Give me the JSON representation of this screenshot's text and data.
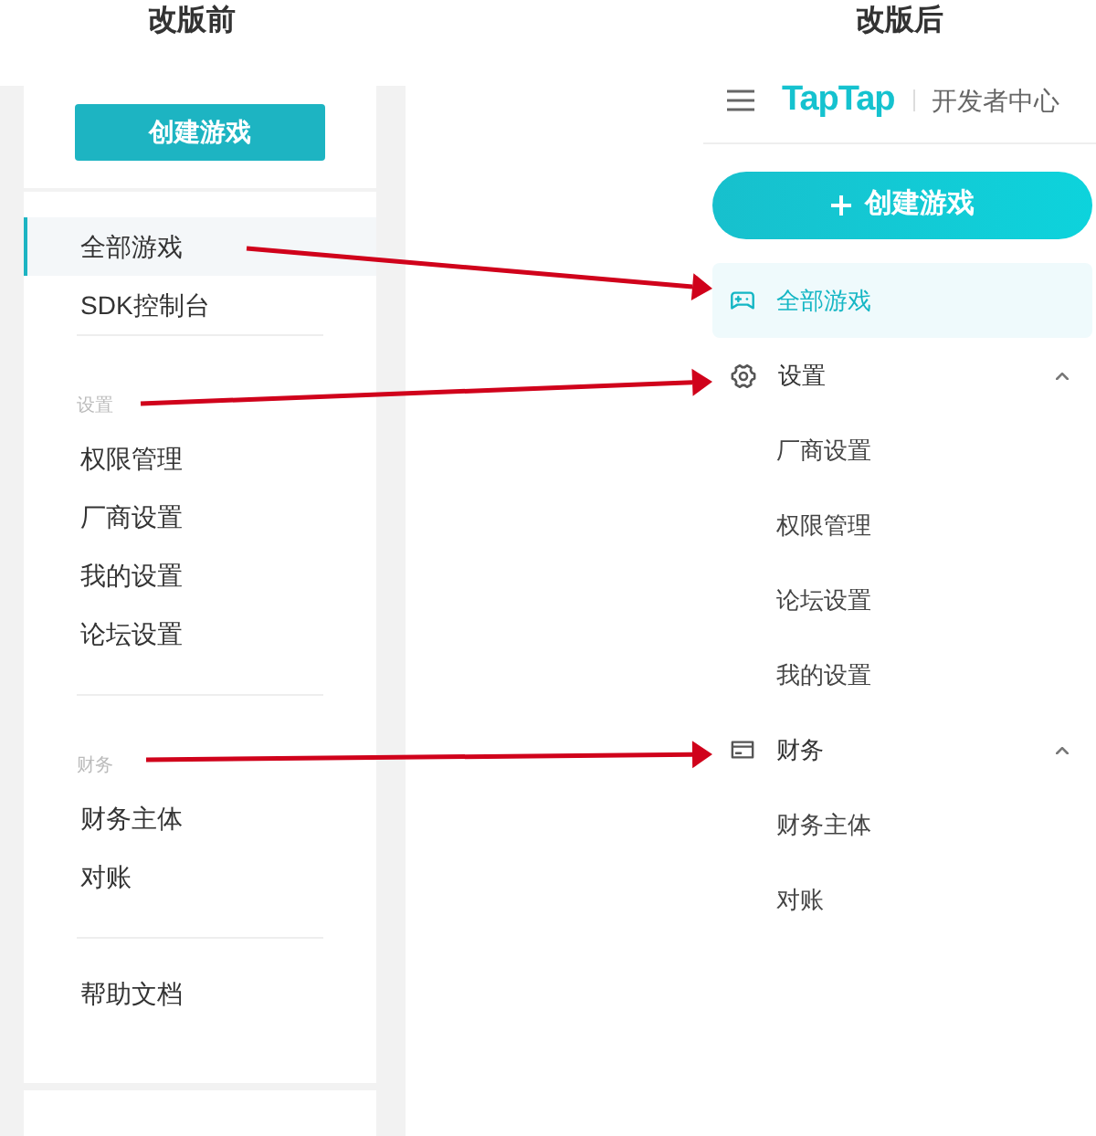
{
  "before": {
    "title": "改版前",
    "create_button": "创建游戏",
    "sections": [
      {
        "items": [
          {
            "label": "全部游戏",
            "selected": true
          },
          {
            "label": "SDK控制台",
            "selected": false
          }
        ]
      },
      {
        "heading": "设置",
        "items": [
          {
            "label": "权限管理",
            "selected": false
          },
          {
            "label": "厂商设置",
            "selected": false
          },
          {
            "label": "我的设置",
            "selected": false
          },
          {
            "label": "论坛设置",
            "selected": false
          }
        ]
      },
      {
        "heading": "财务",
        "items": [
          {
            "label": "财务主体",
            "selected": false
          },
          {
            "label": "对账",
            "selected": false
          }
        ]
      },
      {
        "items": [
          {
            "label": "帮助文档",
            "selected": false
          }
        ]
      }
    ]
  },
  "after": {
    "title": "改版后",
    "header": {
      "logo": "TapTap",
      "subtitle": "开发者中心"
    },
    "create_button": "创建游戏",
    "nav": [
      {
        "label": "全部游戏",
        "selected": true
      },
      {
        "label": "设置",
        "selected": false,
        "expanded": true,
        "children": [
          {
            "label": "厂商设置",
            "selected": false
          },
          {
            "label": "权限管理",
            "selected": false
          },
          {
            "label": "论坛设置",
            "selected": false
          },
          {
            "label": "我的设置",
            "selected": false
          }
        ]
      },
      {
        "label": "财务",
        "selected": false,
        "expanded": true,
        "children": [
          {
            "label": "财务主体",
            "selected": false
          },
          {
            "label": "对账",
            "selected": false
          }
        ]
      }
    ]
  }
}
